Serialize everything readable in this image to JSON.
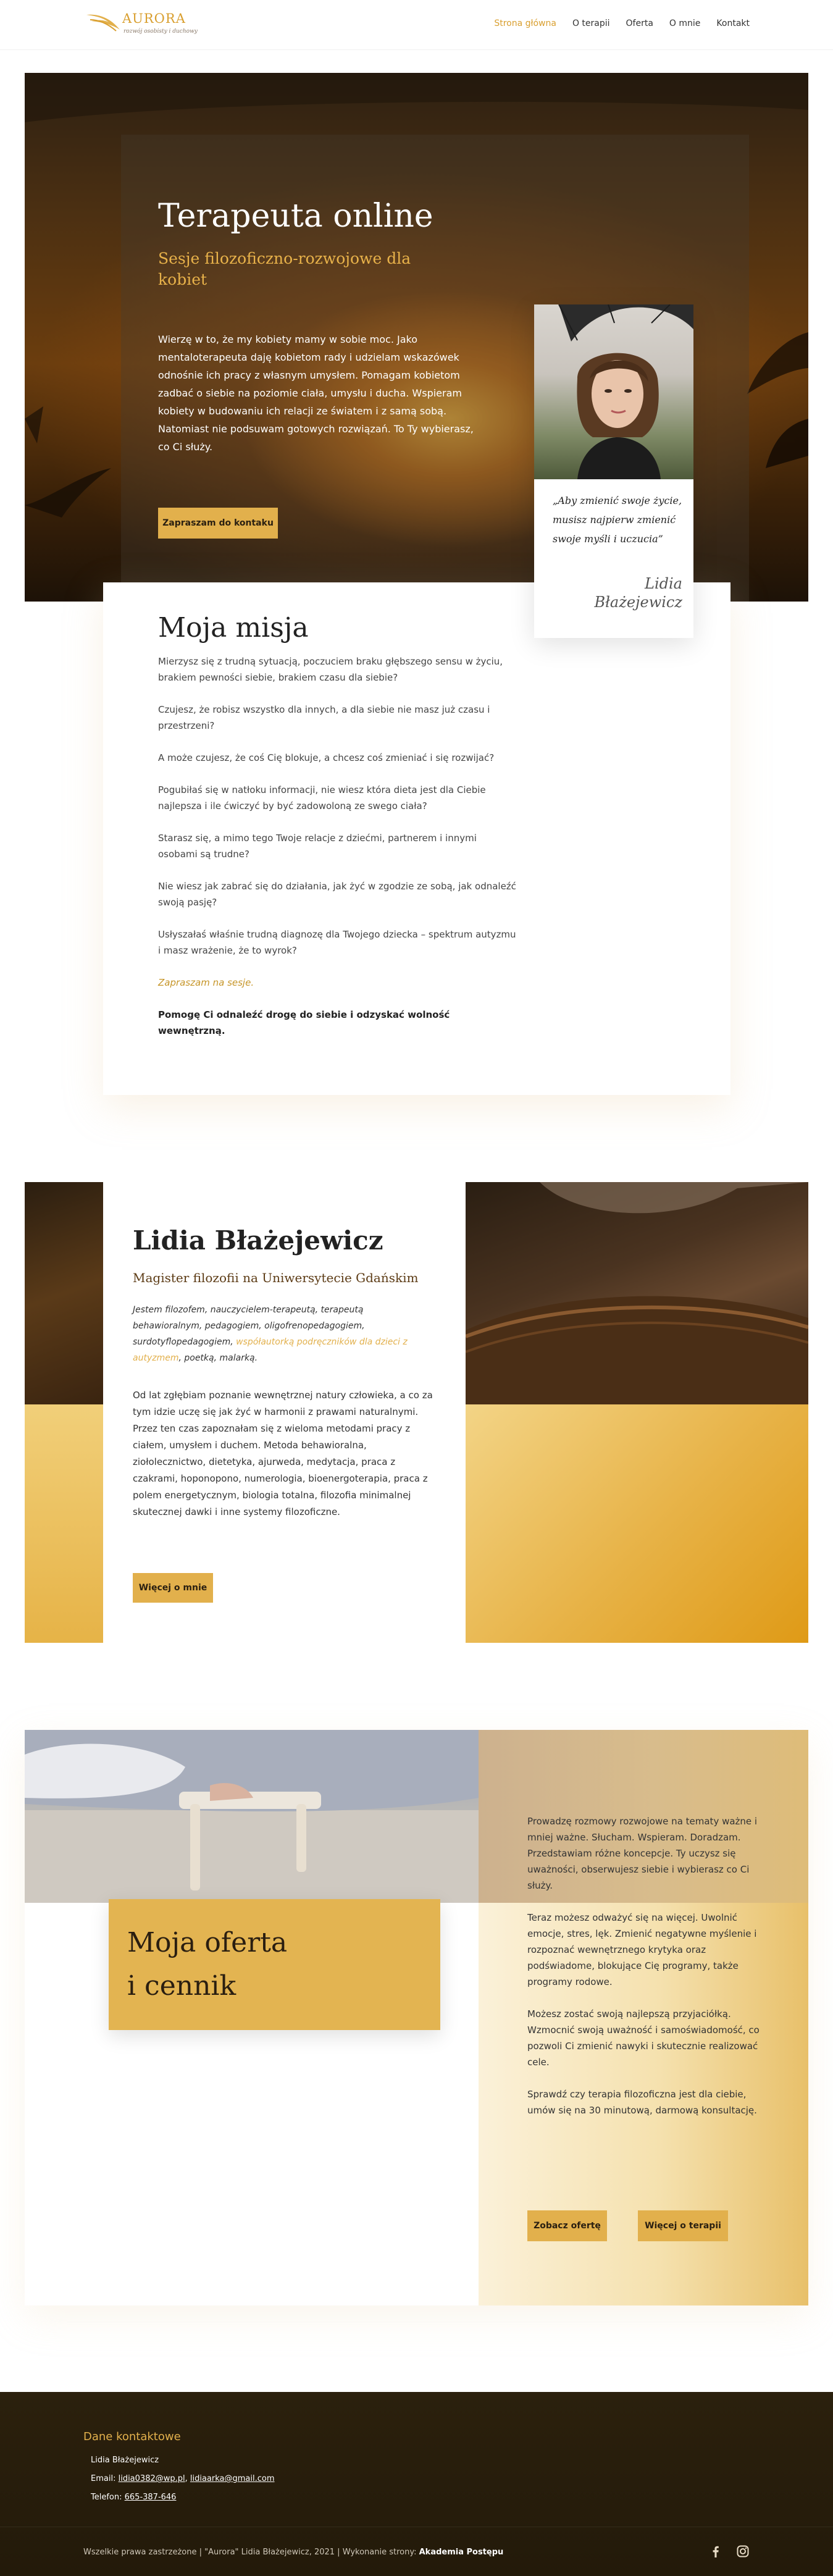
{
  "header": {
    "logo_name": "AURORA",
    "logo_tagline": "rozwój osobisty i duchowy",
    "nav": [
      "Strona główna",
      "O terapii",
      "Oferta",
      "O mnie",
      "Kontakt"
    ]
  },
  "hero": {
    "title": "Terapeuta online",
    "subtitle": "Sesje filozoficzno-rozwojowe dla kobiet",
    "text": "Wierzę w to, że my kobiety mamy w sobie moc. Jako mentaloterapeuta daję kobietom rady i udzielam wskazówek odnośnie ich pracy z własnym umysłem. Pomagam kobietom zadbać o siebie na poziomie ciała, umysłu i ducha. Wspieram kobiety w budowaniu ich relacji ze światem i z samą sobą. Natomiast nie podsuwam gotowych rozwiązań. To Ty wybierasz, co Ci służy.",
    "button": "Zapraszam do kontaku",
    "quote": "„Aby zmienić swoje życie, musisz najpierw zmienić swoje myśli i uczucia”",
    "signature": "Lidia Błażejewicz"
  },
  "mission": {
    "title": "Moja misja",
    "paragraphs": [
      "Mierzysz się z trudną sytuacją, poczuciem braku głębszego sensu w życiu, brakiem pewności siebie, brakiem czasu dla siebie?",
      "Czujesz, że robisz wszystko dla innych, a dla siebie nie masz już czasu i przestrzeni?",
      "A może czujesz, że coś Cię blokuje, a chcesz coś zmieniać i się rozwijać?",
      "Pogubiłaś się w natłoku informacji, nie wiesz która dieta jest dla Ciebie najlepsza i ile ćwiczyć by być zadowoloną ze swego ciała?",
      "Starasz się, a mimo tego Twoje relacje z dziećmi, partnerem i innymi osobami są trudne?",
      "Nie wiesz jak zabrać się do działania, jak żyć w zgodzie ze sobą, jak odnaleźć swoją pasję?",
      "Usłyszałaś właśnie trudną diagnozę dla Twojego dziecka – spektrum autyzmu i masz wrażenie, że to wyrok?"
    ],
    "invite": "Zapraszam na sesje.",
    "closing": "Pomogę Ci odnaleźć drogę do siebie i odzyskać wolność wewnętrzną."
  },
  "bio": {
    "name": "Lidia Błażejewicz",
    "title": "Magister filozofii na Uniwersytecie Gdańskim",
    "intro_start": "Jestem filozofem, nauczycielem-terapeutą, terapeutą behawioralnym, pedagogiem, oligofrenopedagogiem, surdotyflopedagogiem, ",
    "intro_link": "współautorką podręczników dla dzieci z autyzmem",
    "intro_end": ", poetką, malarką.",
    "text": "Od lat zgłębiam poznanie wewnętrznej natury człowieka, a co za tym idzie uczę się jak żyć w harmonii z prawami naturalnymi. Przez ten czas zapoznałam się z wieloma metodami pracy z ciałem, umysłem i duchem. Metoda behawioralna, ziołolecznictwo, dietetyka, ajurweda, medytacja, praca z czakrami, hoponopono, numerologia, bioenergoterapia, praca z polem energetycznym, biologia totalna, filozofia minimalnej skutecznej dawki i inne systemy filozoficzne.",
    "button": "Więcej o mnie"
  },
  "offer": {
    "title_line1": "Moja oferta",
    "title_line2": "i cennik",
    "paragraphs": [
      "Prowadzę rozmowy rozwojowe na tematy ważne i mniej ważne. Słucham. Wspieram. Doradzam. Przedstawiam różne koncepcje. Ty uczysz się uważności, obserwujesz siebie i wybierasz co Ci służy.",
      "Teraz możesz odważyć się na więcej. Uwolnić emocje, stres, lęk. Zmienić negatywne myślenie i rozpoznać wewnętrznego krytyka oraz podświadome, blokujące Cię programy, także programy rodowe.",
      "Możesz zostać swoją najlepszą przyjaciółką. Wzmocnić swoją uważność i samoświadomość, co pozwoli Ci zmienić nawyki i skutecznie realizować cele.",
      "Sprawdź czy terapia filozoficzna jest dla ciebie, umów się na 30 minutową, darmową konsultację."
    ],
    "button_offer": "Zobacz ofertę",
    "button_therapy": "Więcej o terapii"
  },
  "footer": {
    "heading": "Dane kontaktowe",
    "name": "Lidia Błażejewicz",
    "email_label": "Email: ",
    "email1": "lidia0382@wp.pl",
    "email_sep": ", ",
    "email2": "lidiaarka@gmail.com",
    "phone_label": "Telefon: ",
    "phone": "665-387-646",
    "copyright": "Wszelkie prawa zastrzeżone | \"Aurora\" Lidia Błażejewicz, 2021 | Wykonanie strony: ",
    "credit": "Akademia Postępu",
    "social_icons": [
      "facebook-icon",
      "instagram-icon"
    ]
  },
  "colors": {
    "accent": "#e2b04c",
    "nav_active": "#d99f2f",
    "footer_bg": "#2b200d"
  }
}
